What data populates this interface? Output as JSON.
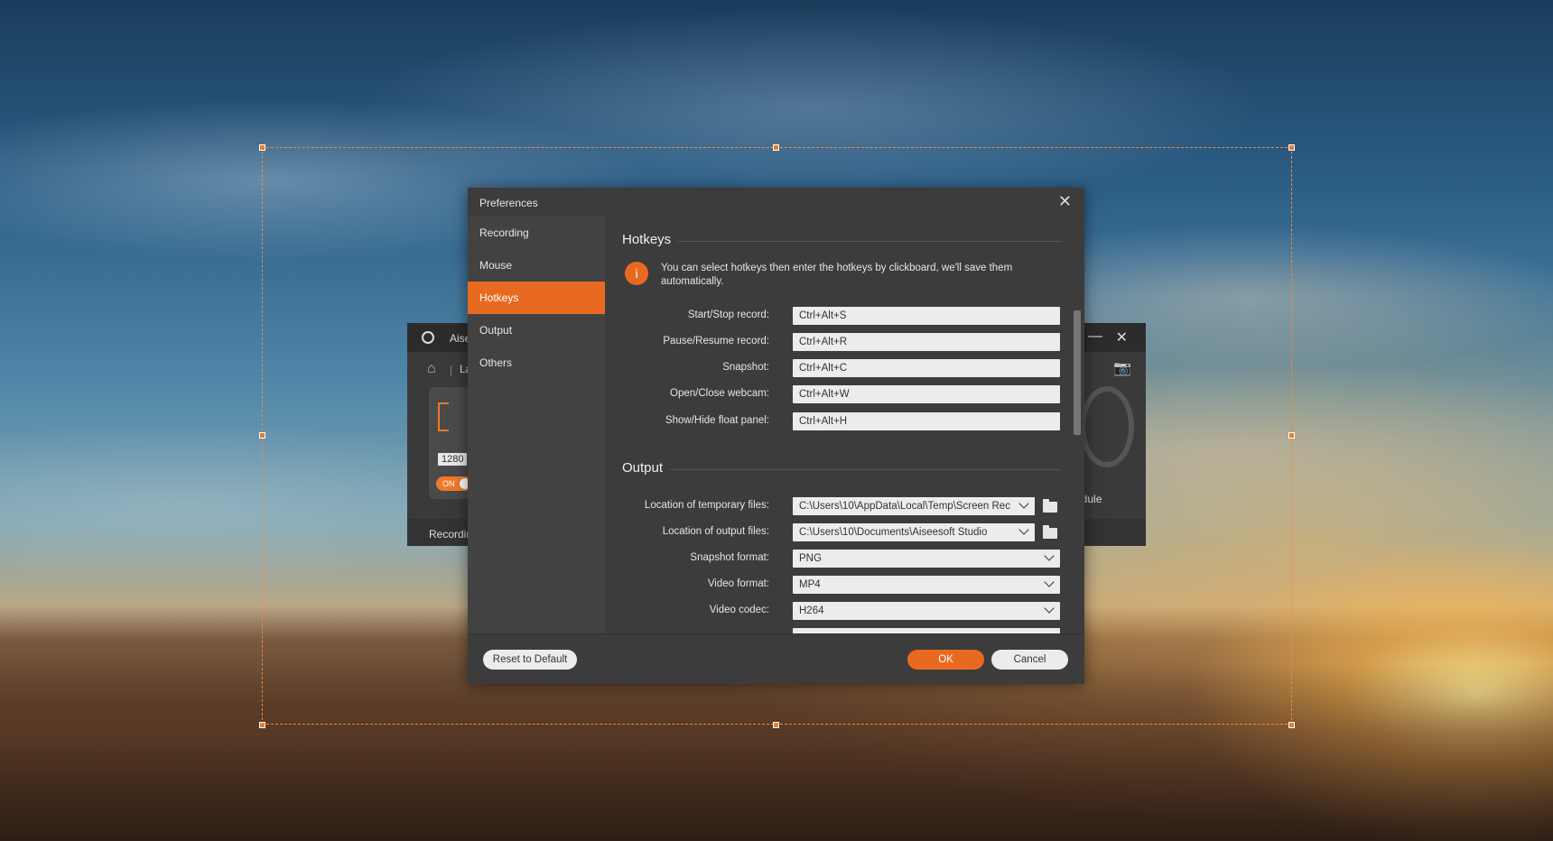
{
  "background_window": {
    "title": "Aise",
    "tab": "La",
    "resolution": "1280",
    "toggle": "ON",
    "bottom_label": "Recordin",
    "schedule_label": "edule"
  },
  "dialog": {
    "title": "Preferences",
    "sidebar": [
      {
        "label": "Recording"
      },
      {
        "label": "Mouse"
      },
      {
        "label": "Hotkeys",
        "active": true
      },
      {
        "label": "Output"
      },
      {
        "label": "Others"
      }
    ],
    "hotkeys": {
      "title": "Hotkeys",
      "info": "You can select hotkeys then enter the hotkeys by clickboard, we'll save them automatically.",
      "rows": [
        {
          "label": "Start/Stop record:",
          "value": "Ctrl+Alt+S"
        },
        {
          "label": "Pause/Resume record:",
          "value": "Ctrl+Alt+R"
        },
        {
          "label": "Snapshot:",
          "value": "Ctrl+Alt+C"
        },
        {
          "label": "Open/Close webcam:",
          "value": "Ctrl+Alt+W"
        },
        {
          "label": "Show/Hide float panel:",
          "value": "Ctrl+Alt+H"
        }
      ]
    },
    "output": {
      "title": "Output",
      "rows": [
        {
          "label": "Location of temporary files:",
          "value": "C:\\Users\\10\\AppData\\Local\\Temp\\Screen Rec"
        },
        {
          "label": "Location of output files:",
          "value": "C:\\Users\\10\\Documents\\Aiseesoft Studio"
        },
        {
          "label": "Snapshot format:",
          "value": "PNG"
        },
        {
          "label": "Video format:",
          "value": "MP4"
        },
        {
          "label": "Video codec:",
          "value": "H264"
        }
      ]
    },
    "buttons": {
      "reset": "Reset to Default",
      "ok": "OK",
      "cancel": "Cancel"
    }
  },
  "colors": {
    "accent": "#e86a21",
    "dialog_bg": "#3c3c3c",
    "sidebar_bg": "#424242"
  }
}
